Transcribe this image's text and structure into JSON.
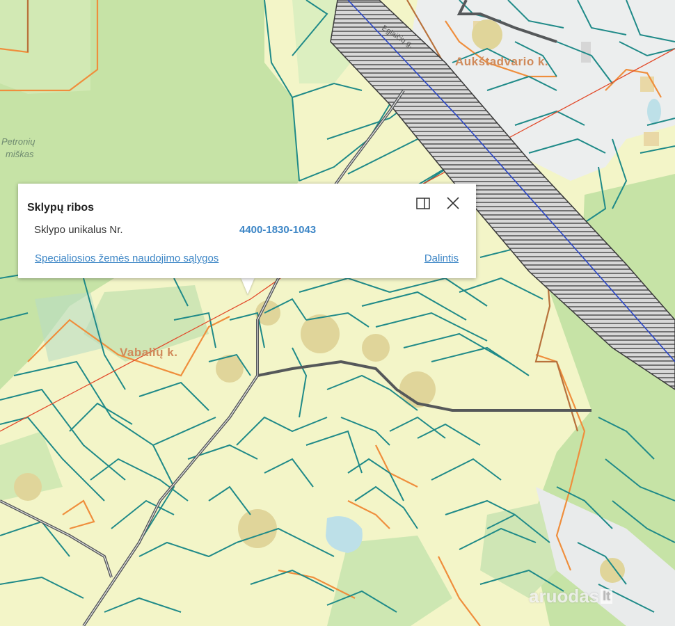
{
  "map": {
    "labels": {
      "village_1": "Aukštadvario k.",
      "village_2": "Vabalių k.",
      "forest": [
        "Petronių",
        "miškas"
      ],
      "street": "Eglaičių g."
    },
    "watermark": {
      "text": "aruodas",
      "suffix": "lt"
    },
    "colors": {
      "parcel_border": "#1f8a88",
      "forest": "#c6e3a6",
      "farmland": "#f3f5c8",
      "road": "#55585a",
      "railway_hatch": "#3a3a3a",
      "rail_line": "#2a46c8",
      "power_line": "#e24a2a",
      "zone_border": "#ef8e3c"
    }
  },
  "popup": {
    "title": "Sklypų ribos",
    "row_label": "Sklypo unikalus Nr.",
    "row_value": "4400-1830-1043",
    "link_conditions": "Specialiosios žemės naudojimo sąlygos",
    "link_share": "Dalintis",
    "icon_dock": "dock-side-icon",
    "icon_close": "close-icon"
  }
}
